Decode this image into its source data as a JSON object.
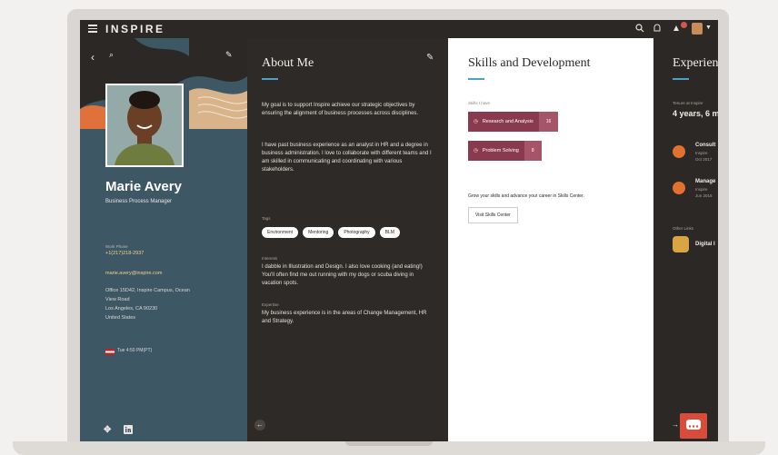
{
  "app": {
    "brand": "INSPIRE"
  },
  "topbar": {
    "icons": [
      "search-icon",
      "notifications-icon",
      "alert-icon",
      "avatar",
      "chevron-down-icon"
    ]
  },
  "profile": {
    "name": "Marie Avery",
    "job_title": "Business Process Manager",
    "work_phone_label": "Work Phone",
    "work_phone": "+1(217)218-2937",
    "email": "marie.avery@inspire.com",
    "address": [
      "Office 15D42, Inspire Campus, Ocean",
      "View Road",
      "Los Angeles, CA 90230",
      "United States"
    ],
    "local_time": "Tue 4:50 PM(PT)",
    "colors": {
      "panel": "#3e5765",
      "accent_orange": "#e0713a",
      "accent_gold": "#f1d38c"
    }
  },
  "about": {
    "title": "About Me",
    "para1": "My goal is to support Inspire achieve our strategic objectives by ensuring the alignment of business processes across disciplines.",
    "para2": "I have past business experience as an analyst in HR and a degree in business administration. I love to collaborate with different teams and I am skilled in communicating and coordinating with various stakeholders.",
    "tags_label": "Tags",
    "tags": [
      "Environment",
      "Mentoring",
      "Photography",
      "BLM"
    ],
    "interests_label": "Interests",
    "interests": "I dabble in Illustration and Design. I also love cooking (and eating!) You'll often find me out running with my dogs or scuba diving in vacation spots.",
    "expertise_label": "Expertise",
    "expertise": "My business experience is in the areas of Change Management, HR and Strategy."
  },
  "skills": {
    "title": "Skills and Development",
    "skills_label": "Skills I have",
    "items": [
      {
        "name": "Research and Analysis",
        "count": "16"
      },
      {
        "name": "Problem Solving",
        "count": "8"
      }
    ],
    "grow_text": "Grow your skills and advance your career in Skills Center.",
    "visit_button": "Visit Skills Center",
    "colors": {
      "skill": "#8a3a4f",
      "count": "#a55567",
      "accent": "#4aa3c7"
    }
  },
  "experience": {
    "title": "Experien",
    "tenure_label": "Tenure at Inspire",
    "tenure": "4 years, 6 m",
    "items": [
      {
        "title": "Consult",
        "company": "Inspire",
        "date": "Oct 2017"
      },
      {
        "title": "Manage",
        "company": "Inspire",
        "date": "Jun 2015"
      }
    ],
    "other_links_label": "Other Links",
    "other_link": "Digital I"
  }
}
